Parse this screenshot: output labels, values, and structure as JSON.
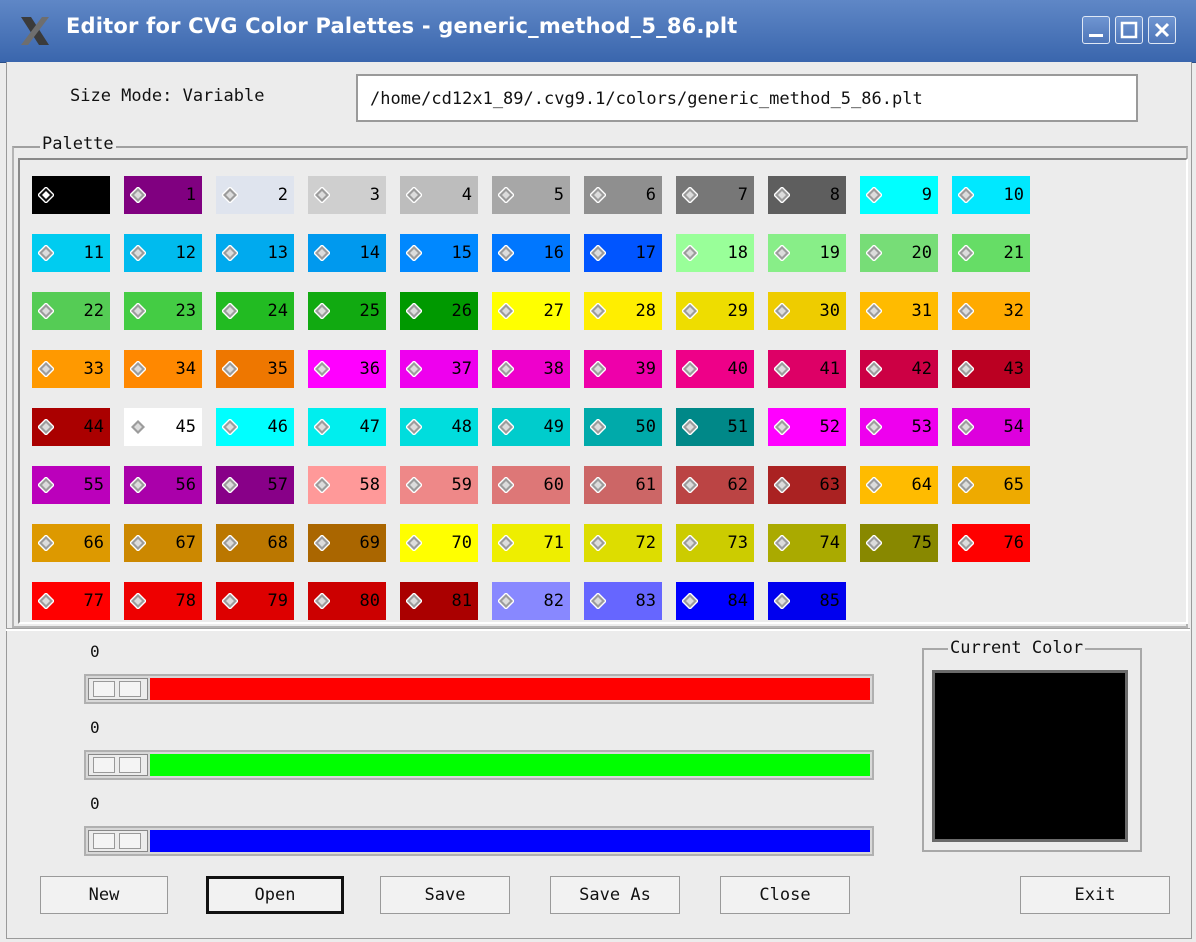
{
  "window": {
    "title": "Editor for CVG Color Palettes - generic_method_5_86.plt",
    "controls": [
      "minimize-icon",
      "maximize-icon",
      "close-icon"
    ]
  },
  "header": {
    "size_mode": "Size Mode: Variable",
    "path": "/home/cd12x1_89/.cvg9.1/colors/generic_method_5_86.plt"
  },
  "palette": {
    "label": "Palette",
    "swatches": [
      {
        "n": "",
        "c": "#000000",
        "t": "#ffffff"
      },
      {
        "n": "1",
        "c": "#800080",
        "t": "#000000"
      },
      {
        "n": "2",
        "c": "#dfe4ee",
        "t": "#000000"
      },
      {
        "n": "3",
        "c": "#cfcfcf",
        "t": "#000000"
      },
      {
        "n": "4",
        "c": "#bdbdbd",
        "t": "#000000"
      },
      {
        "n": "5",
        "c": "#a7a7a7",
        "t": "#000000"
      },
      {
        "n": "6",
        "c": "#8f8f8f",
        "t": "#000000"
      },
      {
        "n": "7",
        "c": "#777777",
        "t": "#000000"
      },
      {
        "n": "8",
        "c": "#5e5e5e",
        "t": "#000000"
      },
      {
        "n": "9",
        "c": "#00ffff",
        "t": "#000000"
      },
      {
        "n": "10",
        "c": "#00e8ff",
        "t": "#000000"
      },
      {
        "n": "11",
        "c": "#00ccf0",
        "t": "#000000"
      },
      {
        "n": "12",
        "c": "#00bbee",
        "t": "#000000"
      },
      {
        "n": "13",
        "c": "#00aaee",
        "t": "#000000"
      },
      {
        "n": "14",
        "c": "#0099ee",
        "t": "#000000"
      },
      {
        "n": "15",
        "c": "#0088ff",
        "t": "#000000"
      },
      {
        "n": "16",
        "c": "#0077ff",
        "t": "#000000"
      },
      {
        "n": "17",
        "c": "#0055ff",
        "t": "#000000"
      },
      {
        "n": "18",
        "c": "#99ff99",
        "t": "#000000"
      },
      {
        "n": "19",
        "c": "#88ee88",
        "t": "#000000"
      },
      {
        "n": "20",
        "c": "#77dd77",
        "t": "#000000"
      },
      {
        "n": "21",
        "c": "#66dd66",
        "t": "#000000"
      },
      {
        "n": "22",
        "c": "#55cc55",
        "t": "#000000"
      },
      {
        "n": "23",
        "c": "#44cc44",
        "t": "#000000"
      },
      {
        "n": "24",
        "c": "#22bb22",
        "t": "#000000"
      },
      {
        "n": "25",
        "c": "#11aa11",
        "t": "#000000"
      },
      {
        "n": "26",
        "c": "#009900",
        "t": "#000000"
      },
      {
        "n": "27",
        "c": "#ffff00",
        "t": "#000000"
      },
      {
        "n": "28",
        "c": "#ffee00",
        "t": "#000000"
      },
      {
        "n": "29",
        "c": "#eedd00",
        "t": "#000000"
      },
      {
        "n": "30",
        "c": "#eecc00",
        "t": "#000000"
      },
      {
        "n": "31",
        "c": "#ffbb00",
        "t": "#000000"
      },
      {
        "n": "32",
        "c": "#ffaa00",
        "t": "#000000"
      },
      {
        "n": "33",
        "c": "#ff9900",
        "t": "#000000"
      },
      {
        "n": "34",
        "c": "#ff8800",
        "t": "#000000"
      },
      {
        "n": "35",
        "c": "#ee7700",
        "t": "#000000"
      },
      {
        "n": "36",
        "c": "#ff00ff",
        "t": "#000000"
      },
      {
        "n": "37",
        "c": "#ee00ee",
        "t": "#000000"
      },
      {
        "n": "38",
        "c": "#ee00cc",
        "t": "#000000"
      },
      {
        "n": "39",
        "c": "#ee00aa",
        "t": "#000000"
      },
      {
        "n": "40",
        "c": "#ee0088",
        "t": "#000000"
      },
      {
        "n": "41",
        "c": "#dd0066",
        "t": "#000000"
      },
      {
        "n": "42",
        "c": "#cc0044",
        "t": "#000000"
      },
      {
        "n": "43",
        "c": "#bb0022",
        "t": "#000000"
      },
      {
        "n": "44",
        "c": "#aa0000",
        "t": "#000000"
      },
      {
        "n": "45",
        "c": "#ffffff",
        "t": "#000000"
      },
      {
        "n": "46",
        "c": "#00ffff",
        "t": "#000000"
      },
      {
        "n": "47",
        "c": "#00eeee",
        "t": "#000000"
      },
      {
        "n": "48",
        "c": "#00dddd",
        "t": "#000000"
      },
      {
        "n": "49",
        "c": "#00cccc",
        "t": "#000000"
      },
      {
        "n": "50",
        "c": "#00aaaa",
        "t": "#000000"
      },
      {
        "n": "51",
        "c": "#008888",
        "t": "#000000"
      },
      {
        "n": "52",
        "c": "#ff00ff",
        "t": "#000000"
      },
      {
        "n": "53",
        "c": "#ee00ee",
        "t": "#000000"
      },
      {
        "n": "54",
        "c": "#dd00dd",
        "t": "#000000"
      },
      {
        "n": "55",
        "c": "#bb00bb",
        "t": "#000000"
      },
      {
        "n": "56",
        "c": "#aa00aa",
        "t": "#000000"
      },
      {
        "n": "57",
        "c": "#880088",
        "t": "#000000"
      },
      {
        "n": "58",
        "c": "#ff9999",
        "t": "#000000"
      },
      {
        "n": "59",
        "c": "#ee8888",
        "t": "#000000"
      },
      {
        "n": "60",
        "c": "#dd7777",
        "t": "#000000"
      },
      {
        "n": "61",
        "c": "#cc6666",
        "t": "#000000"
      },
      {
        "n": "62",
        "c": "#bb4444",
        "t": "#000000"
      },
      {
        "n": "63",
        "c": "#aa2222",
        "t": "#000000"
      },
      {
        "n": "64",
        "c": "#ffbb00",
        "t": "#000000"
      },
      {
        "n": "65",
        "c": "#eeaa00",
        "t": "#000000"
      },
      {
        "n": "66",
        "c": "#dd9900",
        "t": "#000000"
      },
      {
        "n": "67",
        "c": "#cc8800",
        "t": "#000000"
      },
      {
        "n": "68",
        "c": "#bb7700",
        "t": "#000000"
      },
      {
        "n": "69",
        "c": "#aa6600",
        "t": "#000000"
      },
      {
        "n": "70",
        "c": "#ffff00",
        "t": "#000000"
      },
      {
        "n": "71",
        "c": "#eeee00",
        "t": "#000000"
      },
      {
        "n": "72",
        "c": "#dddd00",
        "t": "#000000"
      },
      {
        "n": "73",
        "c": "#cccc00",
        "t": "#000000"
      },
      {
        "n": "74",
        "c": "#aaaa00",
        "t": "#000000"
      },
      {
        "n": "75",
        "c": "#888800",
        "t": "#000000"
      },
      {
        "n": "76",
        "c": "#ff0000",
        "t": "#000000"
      },
      {
        "n": "77",
        "c": "#ff0000",
        "t": "#000000"
      },
      {
        "n": "78",
        "c": "#ee0000",
        "t": "#000000"
      },
      {
        "n": "79",
        "c": "#dd0000",
        "t": "#000000"
      },
      {
        "n": "80",
        "c": "#cc0000",
        "t": "#000000"
      },
      {
        "n": "81",
        "c": "#aa0000",
        "t": "#000000"
      },
      {
        "n": "82",
        "c": "#8888ff",
        "t": "#000000"
      },
      {
        "n": "83",
        "c": "#6666ff",
        "t": "#000000"
      },
      {
        "n": "84",
        "c": "#0000ff",
        "t": "#000000"
      },
      {
        "n": "85",
        "c": "#0000ee",
        "t": "#000000"
      }
    ]
  },
  "sliders": [
    {
      "name": "red",
      "value": "0",
      "color": "#ff0000"
    },
    {
      "name": "green",
      "value": "0",
      "color": "#00ff00"
    },
    {
      "name": "blue",
      "value": "0",
      "color": "#0000ff"
    }
  ],
  "current_color": {
    "label": "Current Color",
    "color": "#000000"
  },
  "buttons": {
    "new": "New",
    "open": "Open",
    "save": "Save",
    "save_as": "Save As",
    "close": "Close",
    "exit": "Exit"
  }
}
